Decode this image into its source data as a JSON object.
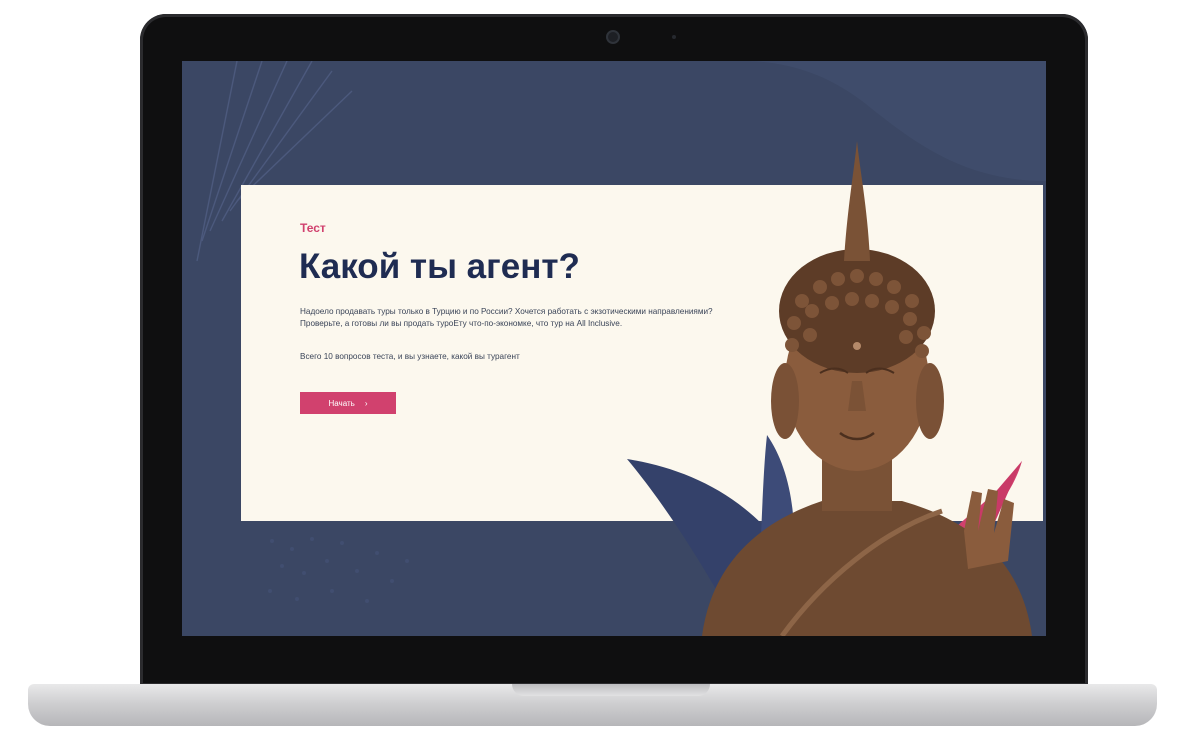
{
  "hero": {
    "eyebrow": "Тест",
    "title": "Какой ты агент?",
    "intro": "Надоело продавать туры только в Турцию и по России? Хочется работать с экзотическими направлениями? Проверьте, а готовы ли вы продать туроЕту что-по-экономке, что тур на All Inclusive.",
    "note": "Всего 10 вопросов теста, и вы узнаете, какой вы турагент",
    "cta_label": "Начать",
    "cta_icon": "arrow-right-icon"
  },
  "colors": {
    "background": "#3b4764",
    "card": "#fcf8ee",
    "accent": "#d1416e",
    "title": "#1f2c52"
  }
}
